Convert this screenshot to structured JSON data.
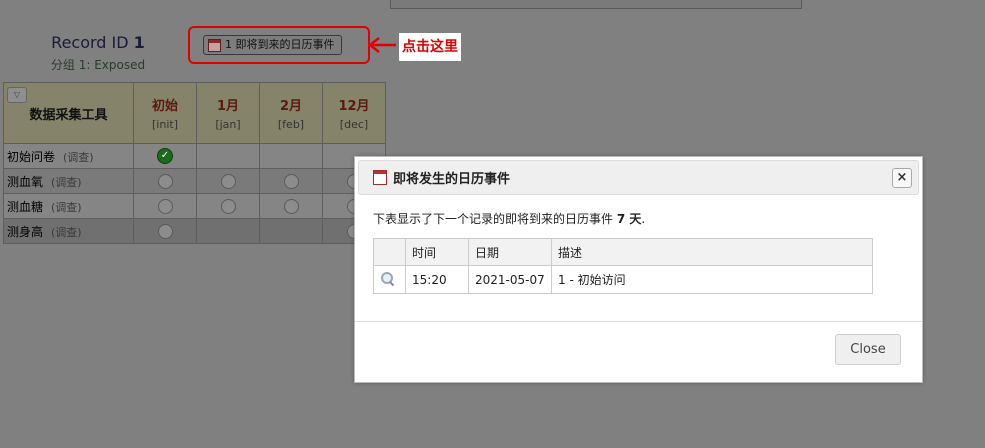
{
  "record": {
    "label": "Record ID",
    "id": "1",
    "group": "分组 1: Exposed"
  },
  "upcoming_button": {
    "label": "1 即将到来的日历事件",
    "icon": "calendar-icon"
  },
  "annotation": {
    "label": "点击这里",
    "color": "#e00000"
  },
  "grid": {
    "instrument_header": "数据采集工具",
    "events": [
      {
        "name": "初始",
        "code": "[init]"
      },
      {
        "name": "1月",
        "code": "[jan]"
      },
      {
        "name": "2月",
        "code": "[feb]"
      },
      {
        "name": "12月",
        "code": "[dec]"
      }
    ],
    "rows": [
      {
        "name": "初始问卷",
        "link": "(调查)",
        "status": [
          "complete",
          "",
          "",
          ""
        ]
      },
      {
        "name": "测血氧",
        "link": "(调查)",
        "status": [
          "empty",
          "empty",
          "empty",
          "empty"
        ]
      },
      {
        "name": "测血糖",
        "link": "(调查)",
        "status": [
          "empty",
          "empty",
          "empty",
          "empty"
        ]
      },
      {
        "name": "测身高",
        "link": "(调查)",
        "status": [
          "empty",
          "",
          "",
          "empty"
        ]
      }
    ]
  },
  "dialog": {
    "title": "即将发生的日历事件",
    "desc_prefix": "下表显示了下一个记录的即将到来的日历事件",
    "days": "7 天",
    "desc_suffix": ".",
    "columns": [
      "时间",
      "日期",
      "描述"
    ],
    "rows": [
      {
        "time": "15:20",
        "date": "2021-05-07",
        "description": "1 - 初始访问"
      }
    ],
    "close_label": "Close",
    "close_x": "×"
  }
}
